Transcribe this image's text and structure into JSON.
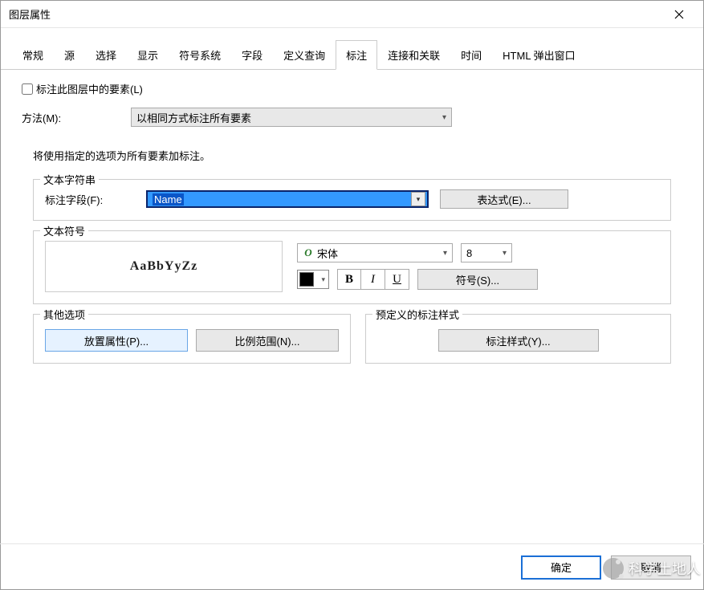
{
  "window": {
    "title": "图层属性"
  },
  "tabs": [
    "常规",
    "源",
    "选择",
    "显示",
    "符号系统",
    "字段",
    "定义查询",
    "标注",
    "连接和关联",
    "时间",
    "HTML 弹出窗口"
  ],
  "active_tab_index": 7,
  "label_group": {
    "checkbox_label": "标注此图层中的要素(L)",
    "method_label": "方法(M):",
    "method_value": "以相同方式标注所有要素",
    "desc": "将使用指定的选项为所有要素加标注。"
  },
  "text_string": {
    "legend": "文本字符串",
    "field_label": "标注字段(F):",
    "field_value": "Name",
    "expr_button": "表达式(E)..."
  },
  "text_symbol": {
    "legend": "文本符号",
    "preview": "AaBbYyZz",
    "font": "宋体",
    "size": "8",
    "bold": "B",
    "italic": "I",
    "underline": "U",
    "symbol_button": "符号(S)..."
  },
  "other": {
    "legend": "其他选项",
    "placement_button": "放置属性(P)...",
    "scale_button": "比例范围(N)..."
  },
  "predef": {
    "legend": "预定义的标注样式",
    "style_button": "标注样式(Y)..."
  },
  "footer": {
    "ok": "确定",
    "cancel": "取消"
  },
  "watermark": "科学土地人"
}
